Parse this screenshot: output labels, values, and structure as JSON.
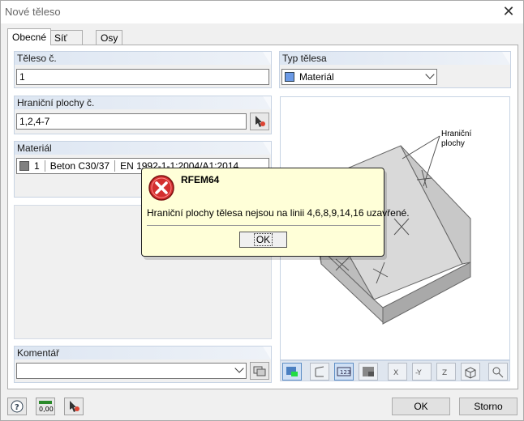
{
  "window": {
    "title": "Nové těleso"
  },
  "tabs": [
    {
      "label": "Obecné"
    },
    {
      "label": "Síť prvků"
    },
    {
      "label": "Osy"
    }
  ],
  "body_no": {
    "label": "Těleso č.",
    "value": "1"
  },
  "boundary": {
    "label": "Hraniční plochy č.",
    "value": "1,2,4-7"
  },
  "material": {
    "label": "Materiál",
    "number": "1",
    "name": "Beton C30/37",
    "standard": "EN 1992-1-1:2004/A1:2014",
    "swatch_color": "#808080"
  },
  "body_type": {
    "label": "Typ tělesa",
    "value": "Materiál",
    "swatch_color": "#6b9ae6"
  },
  "comment": {
    "label": "Komentář",
    "value": ""
  },
  "preview": {
    "annotation_line1": "Hraniční",
    "annotation_line2": "plochy"
  },
  "buttons": {
    "ok": "OK",
    "cancel": "Storno",
    "zero_label": "0,00"
  },
  "modal": {
    "title": "RFEM64",
    "message": "Hraniční plochy tělesa nejsou na linii 4,6,8,9,14,16 uzavřené.",
    "ok": "OK"
  },
  "toolbar_icons": [
    "render-mode-icon",
    "axis-icon",
    "numbering-icon",
    "surface-icon",
    "view-x-icon",
    "view-minus-y-icon",
    "view-z-icon",
    "iso-view-icon",
    "zoom-icon"
  ]
}
